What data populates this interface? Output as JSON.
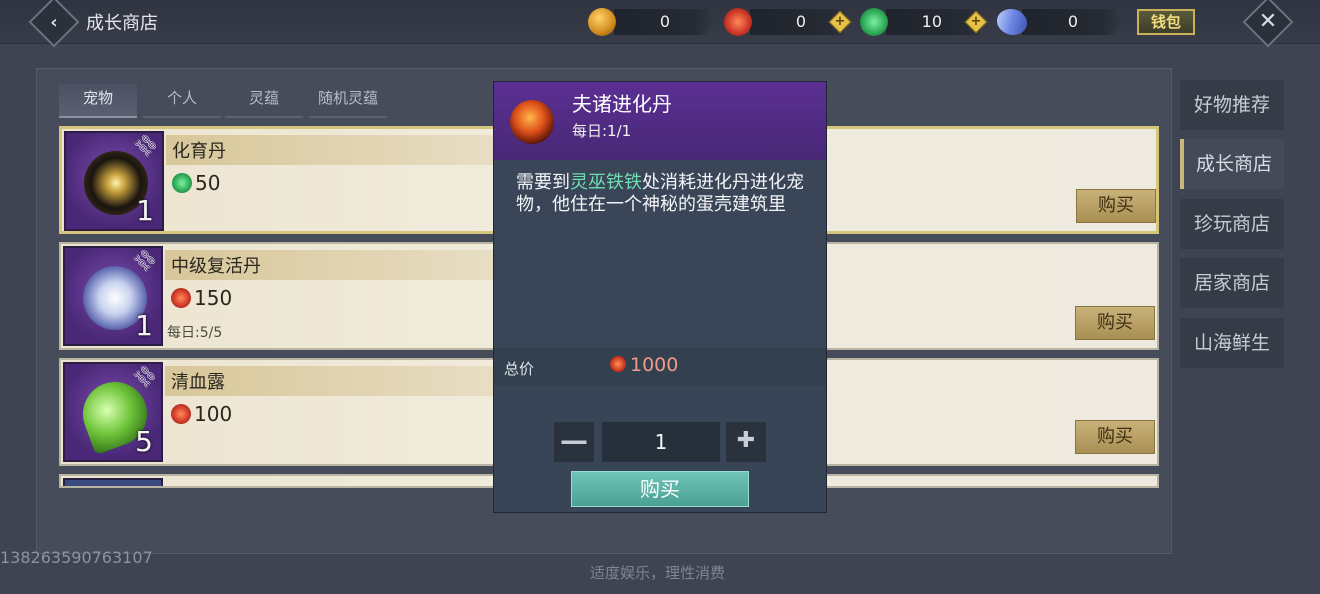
{
  "header": {
    "title": "成长商店",
    "currencies": [
      {
        "icon": "gold-ingot-icon",
        "value": "0",
        "color": "#d08a1c"
      },
      {
        "icon": "red-swirl-coin-icon",
        "value": "0",
        "color": "#d03a2a"
      },
      {
        "icon": "green-jade-coin-icon",
        "value": "10",
        "color": "#2fae5a"
      },
      {
        "icon": "blue-crystal-icon",
        "value": "0",
        "color": "#6b86e0"
      }
    ],
    "wallet_label": "钱包"
  },
  "tabs": [
    {
      "label": "宠物",
      "active": true
    },
    {
      "label": "个人",
      "active": false
    },
    {
      "label": "灵蕴",
      "active": false
    },
    {
      "label": "随机灵蕴",
      "active": false
    }
  ],
  "items": [
    {
      "name": "化育丹",
      "price": "50",
      "currency_icon": "green-jade-coin-icon",
      "qty": "1",
      "daily": "",
      "buy_label": "购买"
    },
    {
      "name": "中级复活丹",
      "price": "150",
      "currency_icon": "red-swirl-coin-icon",
      "qty": "1",
      "daily": "每日:5/5",
      "buy_label": "购买"
    },
    {
      "name": "清血露",
      "price": "100",
      "currency_icon": "red-swirl-coin-icon",
      "qty": "5",
      "daily": "",
      "buy_label": "购买"
    }
  ],
  "side_nav": [
    {
      "label": "好物推荐",
      "active": false
    },
    {
      "label": "成长商店",
      "active": true
    },
    {
      "label": "珍玩商店",
      "active": false
    },
    {
      "label": "居家商店",
      "active": false
    },
    {
      "label": "山海鲜生",
      "active": false
    }
  ],
  "modal": {
    "title": "夫诸进化丹",
    "daily": "每日:1/1",
    "desc_before": "需要到",
    "desc_highlight": "灵巫铁铁",
    "desc_after": "处消耗进化丹进化宠物，他住在一个神秘的蛋壳建筑里",
    "total_label": "总价",
    "total_value": "1000",
    "quantity": "1",
    "minus_label": "—",
    "plus_label": "✚",
    "buy_label": "购买"
  },
  "footer": {
    "note": "适度娱乐，理性消费",
    "account_id": "13826359076310​7"
  }
}
